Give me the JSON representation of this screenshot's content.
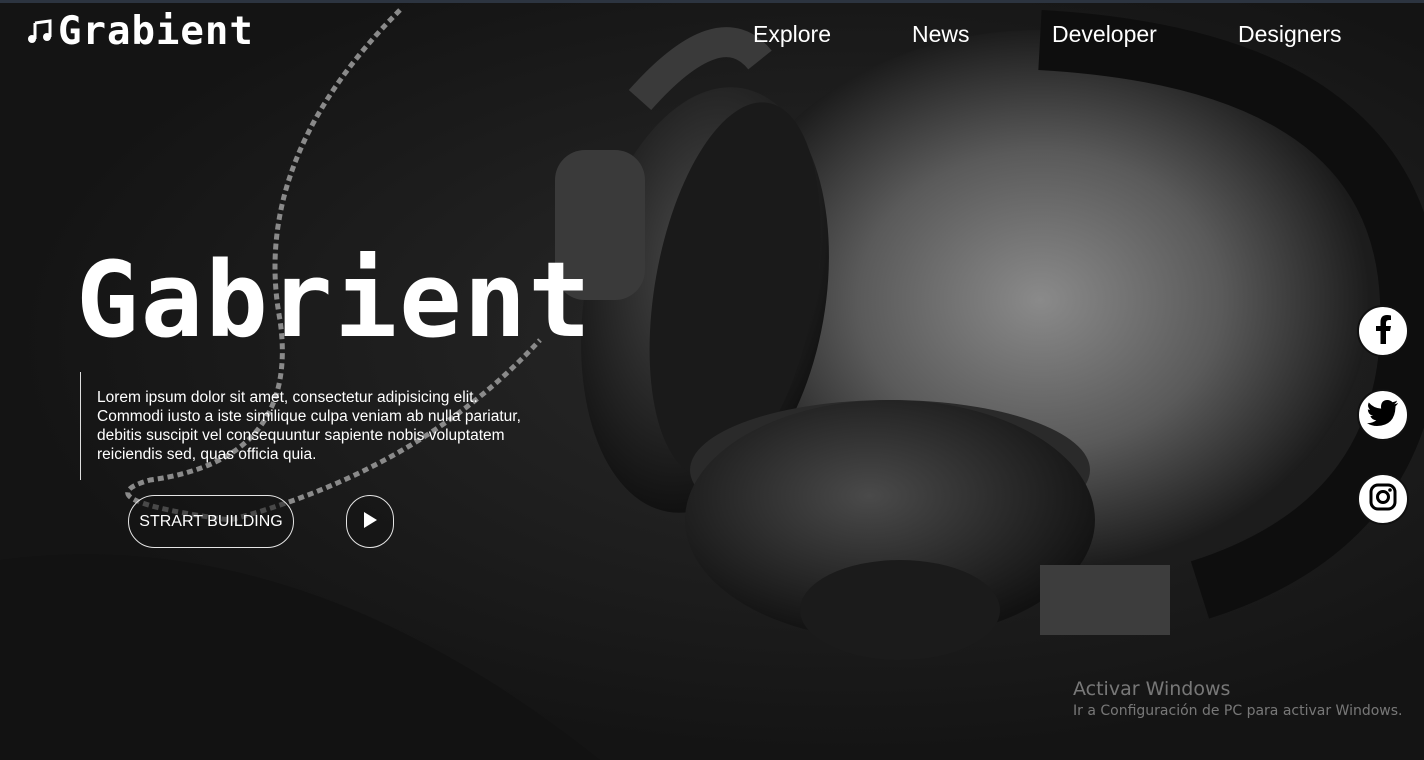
{
  "header": {
    "logo_text": "Grabient",
    "logo_icon": "music-note-icon",
    "nav": [
      "Explore",
      "News",
      "Developer",
      "Designers"
    ]
  },
  "hero": {
    "title": "Gabrient",
    "description": "Lorem ipsum dolor sit amet, consectetur adipisicing elit. Commodi iusto a iste similique culpa veniam ab nulla pariatur, debitis suscipit vel consequuntur sapiente nobis voluptatem reiciendis sed, quas officia quia.",
    "cta_label": "STRART BUILDING",
    "play_icon": "play-icon"
  },
  "social": [
    {
      "name": "facebook-icon"
    },
    {
      "name": "twitter-icon"
    },
    {
      "name": "instagram-icon"
    }
  ],
  "watermark": {
    "title": "Activar Windows",
    "subtitle": "Ir a Configuración de PC para activar Windows."
  },
  "colors": {
    "background": "#161616",
    "text": "#ffffff",
    "accent": "#ffffff"
  }
}
